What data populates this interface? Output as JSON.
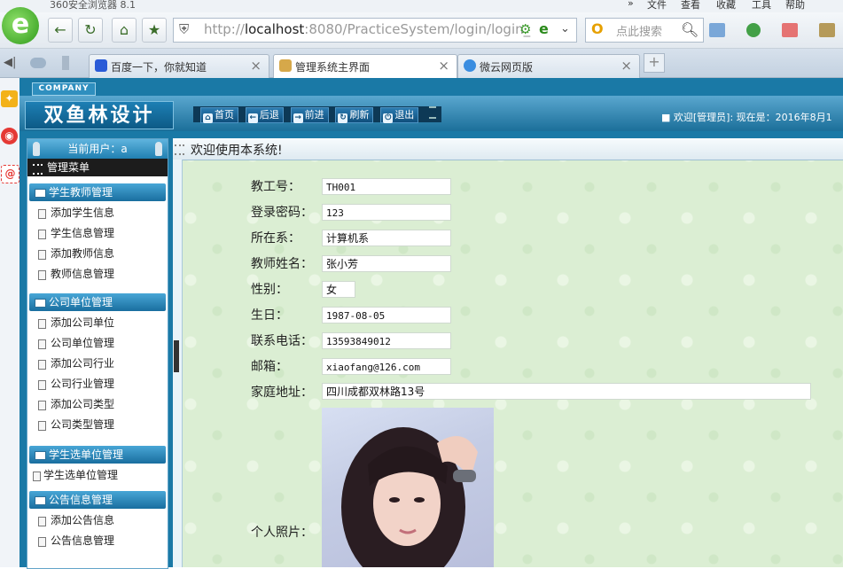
{
  "browser": {
    "title": "360安全浏览器 8.1",
    "menu": [
      "文件",
      "查看",
      "收藏",
      "工具",
      "帮助"
    ],
    "menu_chevron": "»",
    "logo_letter": "e",
    "url_prefix": "http://",
    "url_host": "localhost",
    "url_rest": ":8080/PracticeSystem/login/login_",
    "search_placeholder": "点此搜索",
    "tabs": [
      {
        "label": "百度一下，你就知道",
        "active": false
      },
      {
        "label": "管理系统主界面",
        "active": true
      },
      {
        "label": "微云网页版",
        "active": false
      }
    ]
  },
  "app": {
    "company_badge": "COMPANY",
    "logo_text": "双鱼林设计",
    "nav": [
      "首页",
      "后退",
      "前进",
      "刷新",
      "退出"
    ],
    "welcome": "欢迎[管理员]:   现在是：2016年8月1",
    "current_user": "当前用户：a",
    "menu_title": "管理菜单",
    "menu_sections": [
      {
        "title": "学生教师管理",
        "items": [
          "添加学生信息",
          "学生信息管理",
          "添加教师信息",
          "教师信息管理"
        ]
      },
      {
        "title": "公司单位管理",
        "items": [
          "添加公司单位",
          "公司单位管理",
          "添加公司行业",
          "公司行业管理",
          "添加公司类型",
          "公司类型管理"
        ]
      },
      {
        "title": "学生选单位管理",
        "items": [
          "学生选单位管理"
        ]
      },
      {
        "title": "公告信息管理",
        "items": [
          "添加公告信息",
          "公告信息管理"
        ]
      }
    ],
    "content_title": "欢迎使用本系统!",
    "form": {
      "teacher_no": {
        "label": "教工号：",
        "value": "TH001"
      },
      "password": {
        "label": "登录密码：",
        "value": "123"
      },
      "department": {
        "label": "所在系：",
        "value": "计算机系"
      },
      "name": {
        "label": "教师姓名：",
        "value": "张小芳"
      },
      "gender": {
        "label": "性别：",
        "value": "女"
      },
      "birthday": {
        "label": "生日：",
        "value": "1987-08-05"
      },
      "phone": {
        "label": "联系电话：",
        "value": "13593849012"
      },
      "email": {
        "label": "邮箱：",
        "value": "xiaofang@126.com"
      },
      "address": {
        "label": "家庭地址：",
        "value": "四川成都双林路13号"
      },
      "photo": {
        "label": "个人照片："
      }
    }
  },
  "colors": {
    "app_blue": "#1a79a6",
    "content_green": "#dbeed3",
    "accent_green": "#3b6d2a"
  }
}
